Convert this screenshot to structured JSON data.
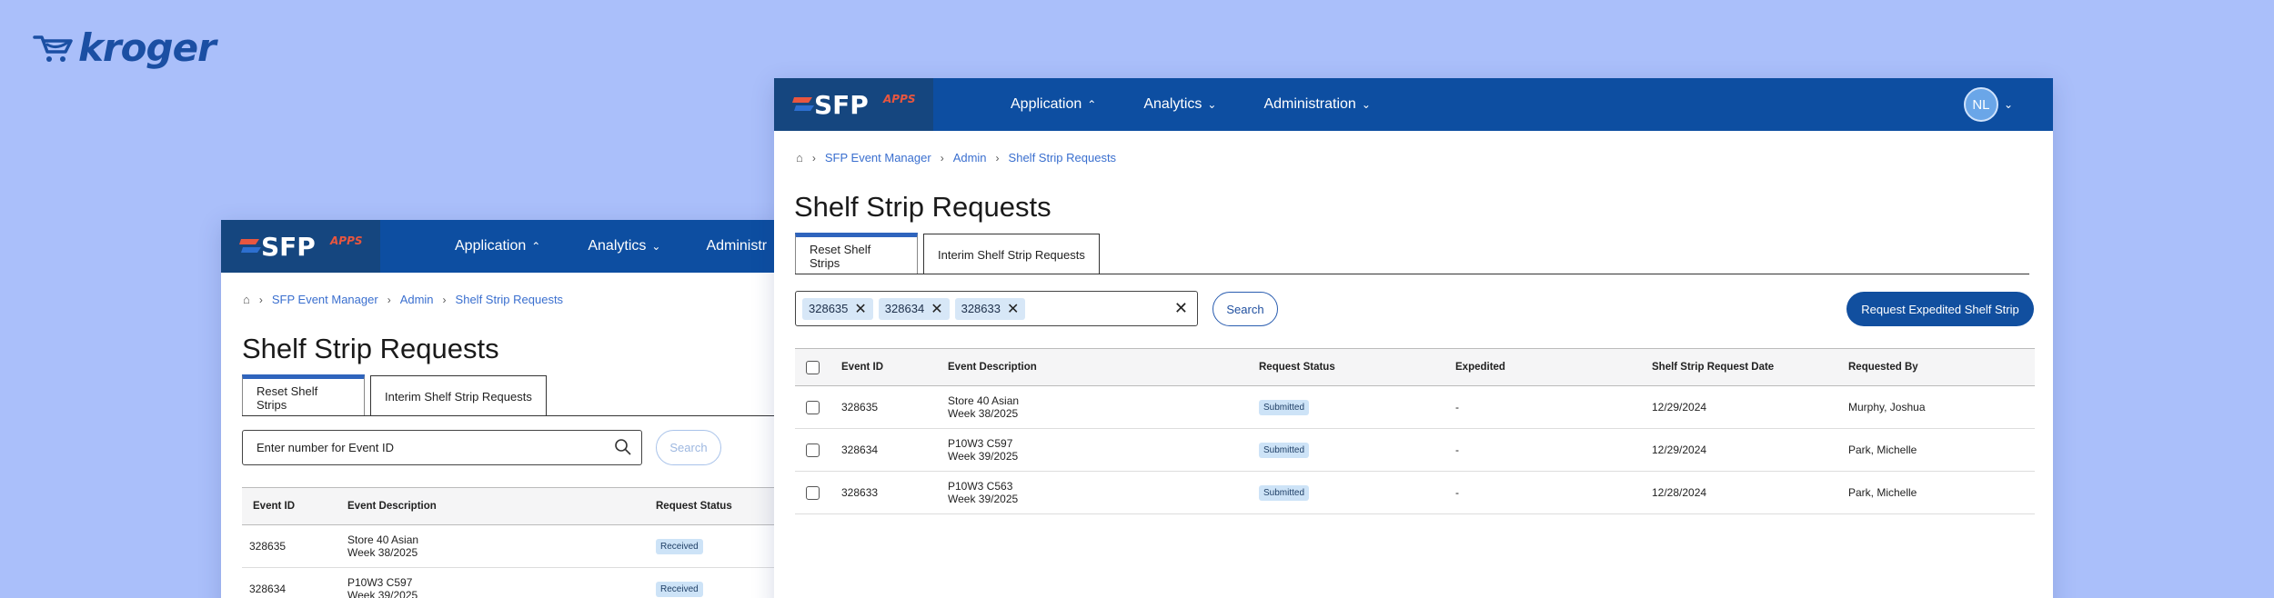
{
  "logo": {
    "text": "kroger",
    "colors": {
      "brand": "#1b4fa3"
    }
  },
  "apps_brand": {
    "primary": "SFP",
    "secondary": "APPS"
  },
  "colors": {
    "topbar": "#0d4ea1",
    "accent": "#2f64bd",
    "badge_bg": "#cde3f7",
    "page_bg": "#aabffa"
  },
  "back": {
    "nav": [
      {
        "label": "Application",
        "icon": "chevron-up-icon"
      },
      {
        "label": "Analytics",
        "icon": "chevron-down-icon"
      },
      {
        "label": "Administr",
        "icon": ""
      }
    ],
    "breadcrumb": [
      "SFP Event Manager",
      "Admin",
      "Shelf Strip Requests"
    ],
    "title": "Shelf Strip Requests",
    "tabs": [
      "Reset Shelf Strips",
      "Interim Shelf Strip Requests"
    ],
    "search": {
      "placeholder": "Enter number for Event ID",
      "button": "Search"
    },
    "columns": [
      "Event ID",
      "Event Description",
      "Request Status"
    ],
    "rows": [
      {
        "id": "328635",
        "desc1": "Store 40 Asian",
        "desc2": "Week 38/2025",
        "status": "Received"
      },
      {
        "id": "328634",
        "desc1": "P10W3 C597",
        "desc2": "Week 39/2025",
        "status": "Received"
      }
    ]
  },
  "front": {
    "nav": [
      {
        "label": "Application",
        "icon": "chevron-up-icon"
      },
      {
        "label": "Analytics",
        "icon": "chevron-down-icon"
      },
      {
        "label": "Administration",
        "icon": "chevron-down-icon"
      }
    ],
    "user_initials": "NL",
    "breadcrumb": [
      "SFP Event Manager",
      "Admin",
      "Shelf Strip Requests"
    ],
    "title": "Shelf Strip Requests",
    "tabs": [
      "Reset Shelf Strips",
      "Interim Shelf Strip Requests"
    ],
    "chips": [
      "328635",
      "328634",
      "328633"
    ],
    "search_button": "Search",
    "expedite_button": "Request Expedited Shelf Strip",
    "columns": [
      "Event ID",
      "Event Description",
      "Request Status",
      "Expedited",
      "Shelf Strip Request Date",
      "Requested By"
    ],
    "rows": [
      {
        "id": "328635",
        "desc1": "Store 40 Asian",
        "desc2": "Week 38/2025",
        "status": "Submitted",
        "expedited": "-",
        "date": "12/29/2024",
        "by": "Murphy, Joshua"
      },
      {
        "id": "328634",
        "desc1": "P10W3 C597",
        "desc2": "Week 39/2025",
        "status": "Submitted",
        "expedited": "-",
        "date": "12/29/2024",
        "by": "Park, Michelle"
      },
      {
        "id": "328633",
        "desc1": "P10W3 C563",
        "desc2": "Week 39/2025",
        "status": "Submitted",
        "expedited": "-",
        "date": "12/28/2024",
        "by": "Park, Michelle"
      }
    ]
  }
}
